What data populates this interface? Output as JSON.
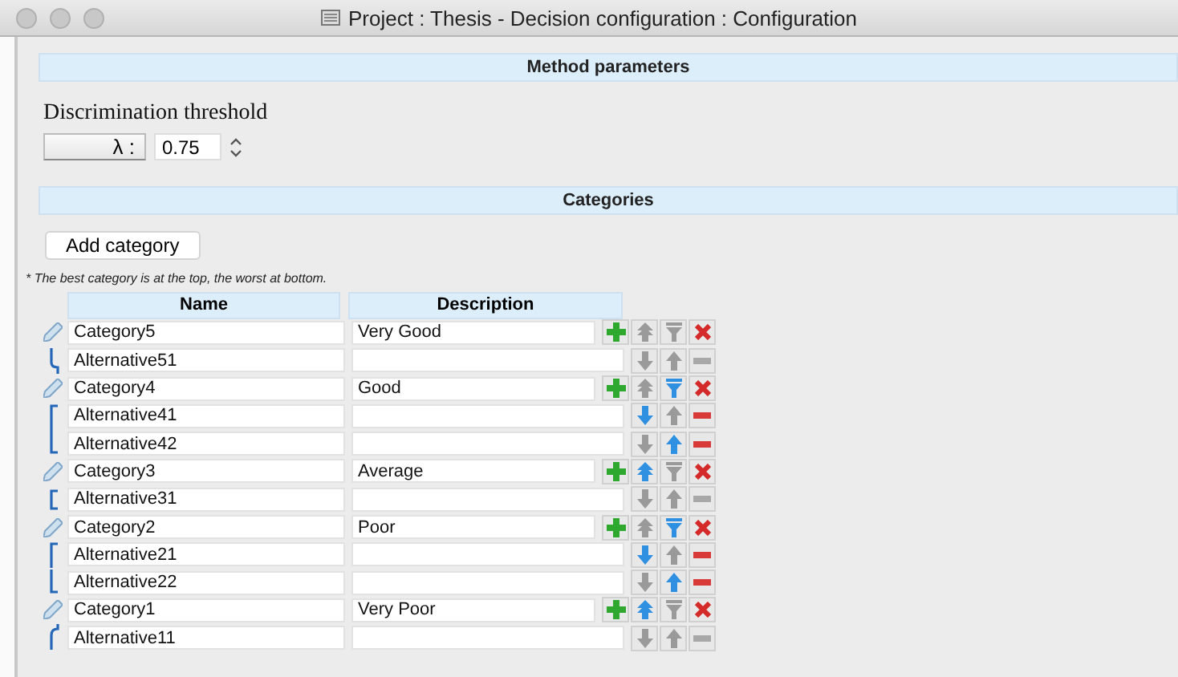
{
  "window": {
    "title": "Project : Thesis - Decision configuration : Configuration"
  },
  "method_parameters": {
    "header": "Method parameters",
    "label": "Discrimination threshold",
    "lambda_button": "λ :",
    "threshold_value": "0.75"
  },
  "categories": {
    "header": "Categories",
    "add_button": "Add category",
    "note": "* The best category is at the top, the worst at bottom.",
    "columns": [
      "Name",
      "Description"
    ],
    "items": [
      {
        "name": "Category5",
        "description": "Very Good",
        "up_enabled": false,
        "down_enabled": false,
        "children": [
          {
            "name": "Alternative51",
            "down_enabled": false,
            "up_enabled": false,
            "remove_enabled": false
          }
        ]
      },
      {
        "name": "Category4",
        "description": "Good",
        "up_enabled": false,
        "down_enabled": true,
        "children": [
          {
            "name": "Alternative41",
            "down_enabled": true,
            "up_enabled": false,
            "remove_enabled": true
          },
          {
            "name": "Alternative42",
            "down_enabled": false,
            "up_enabled": true,
            "remove_enabled": true
          }
        ]
      },
      {
        "name": "Category3",
        "description": "Average",
        "up_enabled": true,
        "down_enabled": false,
        "children": [
          {
            "name": "Alternative31",
            "down_enabled": false,
            "up_enabled": false,
            "remove_enabled": false
          }
        ]
      },
      {
        "name": "Category2",
        "description": "Poor",
        "up_enabled": false,
        "down_enabled": true,
        "children": [
          {
            "name": "Alternative21",
            "down_enabled": true,
            "up_enabled": false,
            "remove_enabled": true
          },
          {
            "name": "Alternative22",
            "down_enabled": false,
            "up_enabled": true,
            "remove_enabled": true
          }
        ]
      },
      {
        "name": "Category1",
        "description": "Very Poor",
        "up_enabled": true,
        "down_enabled": false,
        "children": [
          {
            "name": "Alternative11",
            "down_enabled": false,
            "up_enabled": false,
            "remove_enabled": false
          }
        ]
      }
    ]
  }
}
